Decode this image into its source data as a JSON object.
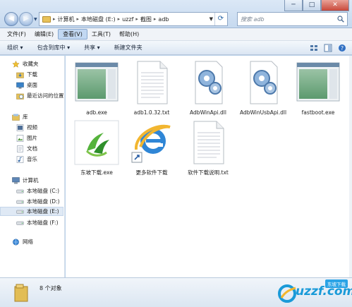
{
  "window": {
    "min_label": "─",
    "max_label": "□",
    "close_label": "✕"
  },
  "address": {
    "crumbs": [
      "计算机",
      "本地磁盘 (E:)",
      "uzzf",
      "截图",
      "adb"
    ],
    "separator": "▸"
  },
  "search": {
    "placeholder": "搜索 adb"
  },
  "menu": [
    "文件(F)",
    "编辑(E)",
    "查看(V)",
    "工具(T)",
    "帮助(H)"
  ],
  "commands": {
    "organize": "组织 ▾",
    "include": "包含到库中 ▾",
    "share": "共享 ▾",
    "new_folder": "新建文件夹"
  },
  "nav": {
    "favorites": "收藏夹",
    "downloads": "下载",
    "desktop": "桌面",
    "recent": "最近访问的位置",
    "libraries": "库",
    "videos": "视频",
    "pictures": "图片",
    "documents": "文档",
    "music": "音乐",
    "computer": "计算机",
    "drive_c": "本地磁盘 (C:)",
    "drive_d": "本地磁盘 (D:)",
    "drive_e": "本地磁盘 (E:)",
    "drive_f": "本地磁盘 (F:)",
    "network": "网络"
  },
  "files": [
    {
      "name": "adb.exe",
      "icon": "app-window-icon"
    },
    {
      "name": "adb1.0.32.txt",
      "icon": "text-file-icon"
    },
    {
      "name": "AdbWinApi.dll",
      "icon": "dll-gear-icon"
    },
    {
      "name": "AdbWinUsbApi.dll",
      "icon": "dll-gear-icon"
    },
    {
      "name": "fastboot.exe",
      "icon": "app-window-icon"
    },
    {
      "name": "东坡下载.exe",
      "icon": "dongpo-logo-icon"
    },
    {
      "name": "更多软件下载",
      "icon": "ie-shortcut-icon"
    },
    {
      "name": "软件下载说明.txt",
      "icon": "text-file-icon"
    }
  ],
  "status": {
    "count": "8 个对象"
  },
  "watermark": {
    "brand": "uzzf.com",
    "badge": "东坡下载"
  }
}
